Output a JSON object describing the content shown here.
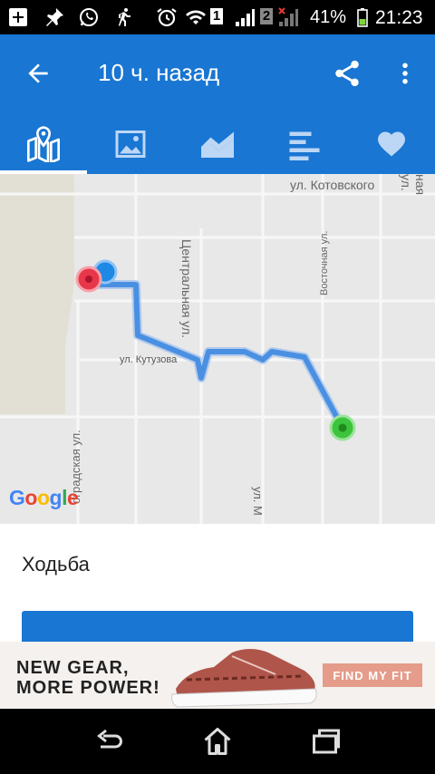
{
  "status_bar": {
    "sim1_badge": "1",
    "sim2_badge": "2",
    "battery_percent": "41%",
    "time": "21:23",
    "icons": [
      "add-icon",
      "pin-icon",
      "whatsapp-icon",
      "runner-icon",
      "alarm-icon",
      "wifi-icon",
      "signal-sim1-icon",
      "signal-sim2-icon",
      "battery-icon"
    ]
  },
  "app_bar": {
    "title": "10 ч. назад",
    "back_icon": "arrow-back-icon",
    "share_icon": "share-icon",
    "more_icon": "more-vert-icon",
    "color": "#1976d2"
  },
  "tabs": [
    {
      "icon": "map-icon",
      "selected": true
    },
    {
      "icon": "image-icon",
      "selected": false
    },
    {
      "icon": "chart-icon",
      "selected": false
    },
    {
      "icon": "splits-icon",
      "selected": false
    },
    {
      "icon": "heart-icon",
      "selected": false
    }
  ],
  "map": {
    "streets": {
      "kotovskogo": "ул. Котовского",
      "vostochnaya_right": "ная ул.",
      "tsentralnaya": "Центральная ул.",
      "vostochnaya": "Восточная ул.",
      "kutuzova": "ул. Кутузова",
      "ogradskaya": "оградская ул.",
      "street_m": "ул. М"
    },
    "logo": "Google",
    "route_color": "#4a90e2",
    "start_color": "#3cc43c",
    "finish_color": "#e8374a",
    "position_color": "#1e88e5"
  },
  "activity": {
    "type": "Ходьба"
  },
  "ad": {
    "headline_line1": "NEW GEAR,",
    "headline_line2": "MORE POWER!",
    "button": "FIND MY FIT"
  },
  "nav_bar": {
    "back_icon": "nav-back-icon",
    "home_icon": "nav-home-icon",
    "recents_icon": "nav-recents-icon"
  }
}
